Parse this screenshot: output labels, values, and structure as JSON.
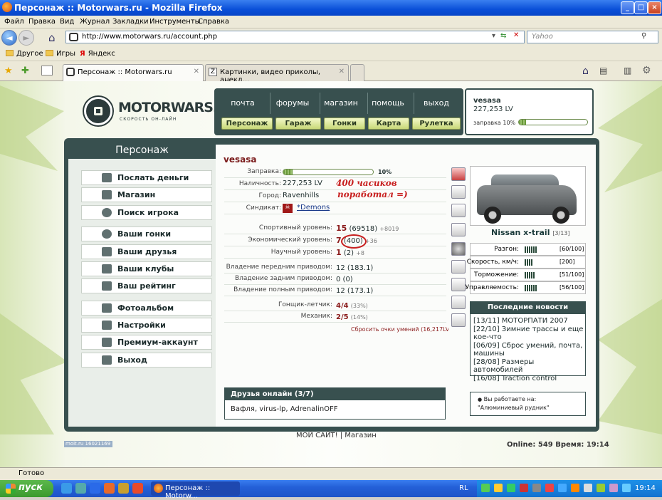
{
  "window": {
    "title": "Персонаж :: Motorwars.ru - Mozilla Firefox"
  },
  "menu": [
    "Файл",
    "Правка",
    "Вид",
    "Журнал",
    "Закладки",
    "Инструменты",
    "Справка"
  ],
  "address": {
    "url": "http://www.motorwars.ru/account.php",
    "search_placeholder": "Yahoo"
  },
  "bookmarks": [
    "Другое",
    "Игры",
    "Яндекс"
  ],
  "tabs": [
    {
      "label": "Персонаж :: Motorwars.ru"
    },
    {
      "label": "Картинки, видео приколы, анекд..."
    }
  ],
  "site": {
    "logo": "MOTORWARS.RU",
    "slogan": "СКОРОСТЬ ОН-ЛАЙН",
    "top_nav": [
      "почта",
      "форумы",
      "магазин",
      "помощь",
      "выход"
    ],
    "sub_nav": [
      "Персонаж",
      "Гараж",
      "Гонки",
      "Карта",
      "Рулетка"
    ]
  },
  "user": {
    "nick": "vesasa",
    "balance": "227,253 LV",
    "fuel_label": "заправка 10%",
    "fuel": 0.1
  },
  "left_panel": {
    "title": "Персонаж",
    "items": [
      "Послать деньги",
      "Магазин",
      "Поиск игрока",
      "Ваши гонки",
      "Ваши друзья",
      "Ваши клубы",
      "Ваш рейтинг",
      "Фотоальбом",
      "Настройки",
      "Премиум-аккаунт",
      "Выход"
    ]
  },
  "character": {
    "name": "vesasa",
    "fuel_label": "Заправка:",
    "fuel_value": "10%",
    "fuel": 0.1,
    "cash_label": "Наличность:",
    "cash": "227,253 LV",
    "city_label": "Город:",
    "city": "Ravenhills",
    "syndicate_label": "Синдикат:",
    "syndicate": "*Demons",
    "sport_label": "Спортивный уровень:",
    "sport_level": "15",
    "sport_points": "(69518)",
    "sport_delta": "+8019",
    "econ_label": "Экономический уровень:",
    "econ_level": "7",
    "econ_points": "(400)",
    "econ_delta": "+36",
    "sci_label": "Научный уровень:",
    "sci_level": "1",
    "sci_points": "(2)",
    "sci_delta": "+8",
    "front_label": "Владение передним приводом:",
    "front_value": "12 (183.1)",
    "rear_label": "Владение задним приводом:",
    "rear_value": "0 (0)",
    "full_label": "Владение полным приводом:",
    "full_value": "12 (173.1)",
    "racer_label": "Гонщик-летчик:",
    "racer_value": "4/4",
    "racer_pct": "(33%)",
    "mech_label": "Механик:",
    "mech_value": "2/5",
    "mech_pct": "(14%)",
    "reset_link": "Сбросить очки умений (16,217LV)"
  },
  "annotation": {
    "line1": "400 часиков",
    "line2": "поработал =)"
  },
  "friends": {
    "title": "Друзья онлайн (3/7)",
    "list": "Вафля, virus-lp, AdrenalinOFF"
  },
  "car": {
    "name": "Nissan x-trail",
    "tag": "[3/13]",
    "stats": [
      {
        "label": "Разгон:",
        "value": "[60/100]",
        "level": 0.6
      },
      {
        "label": "Скорость, км/ч:",
        "value": "[200]",
        "level": 0.4
      },
      {
        "label": "Торможение:",
        "value": "[51/100]",
        "level": 0.51
      },
      {
        "label": "Управляемость:",
        "value": "[56/100]",
        "level": 0.56
      }
    ]
  },
  "news": {
    "title": "Последние новости",
    "items": [
      "[13/11] МОТОРПАТИ 2007",
      "[22/10] Зимние трассы и еще кое-что",
      "[06/09] Сброс умений, почта, машины",
      "[28/08] Размеры автомобилей",
      "[16/08] Traction control"
    ]
  },
  "work": {
    "label": "Вы работаете на:",
    "place": "\"Алюминиевый рудник\""
  },
  "footer": {
    "links": "МОЙ САЙТ! | Магазин",
    "counter": "moit.ru  16021169",
    "online": "Online: 549  Время: 19:14"
  },
  "status": "Готово",
  "taskbar": {
    "start": "пуск",
    "window_button": "Персонаж :: Motorw...",
    "lang": "RL",
    "time": "19:14"
  }
}
